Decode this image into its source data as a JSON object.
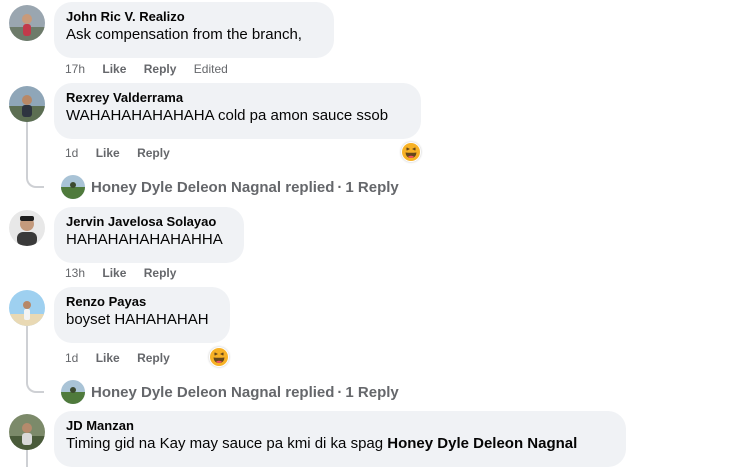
{
  "comments": [
    {
      "author": "John Ric V. Realizo",
      "text": "Ask compensation from the branch,",
      "time": "17h",
      "like": "Like",
      "reply": "Reply",
      "edited": "Edited"
    },
    {
      "author": "Rexrey Valderrama",
      "text": "WAHAHAHAHAHAHA cold pa amon sauce ssob",
      "time": "1d",
      "like": "Like",
      "reply": "Reply",
      "reaction": "laughing-emoji"
    },
    {
      "author": "Jervin Javelosa Solayao",
      "text": "HAHAHAHAHAHAHHA",
      "time": "13h",
      "like": "Like",
      "reply": "Reply"
    },
    {
      "author": "Renzo Payas",
      "text": "boyset HAHAHAHAH",
      "time": "1d",
      "like": "Like",
      "reply": "Reply",
      "reaction": "laughing-emoji"
    },
    {
      "author": "JD Manzan",
      "text": "Timing gid na Kay may sauce pa kmi di ka spag ",
      "mention": "Honey Dyle Deleon Nagnal"
    }
  ],
  "reply_threads": [
    {
      "replier": "Honey Dyle Deleon Nagnal",
      "action": "replied",
      "separator": "·",
      "count": "1 Reply"
    },
    {
      "replier": "Honey Dyle Deleon Nagnal",
      "action": "replied",
      "separator": "·",
      "count": "1 Reply"
    }
  ],
  "colors": {
    "bubble": "#f0f2f5",
    "meta": "#65676b",
    "text": "#050505",
    "thread_line": "#ced0d4"
  }
}
